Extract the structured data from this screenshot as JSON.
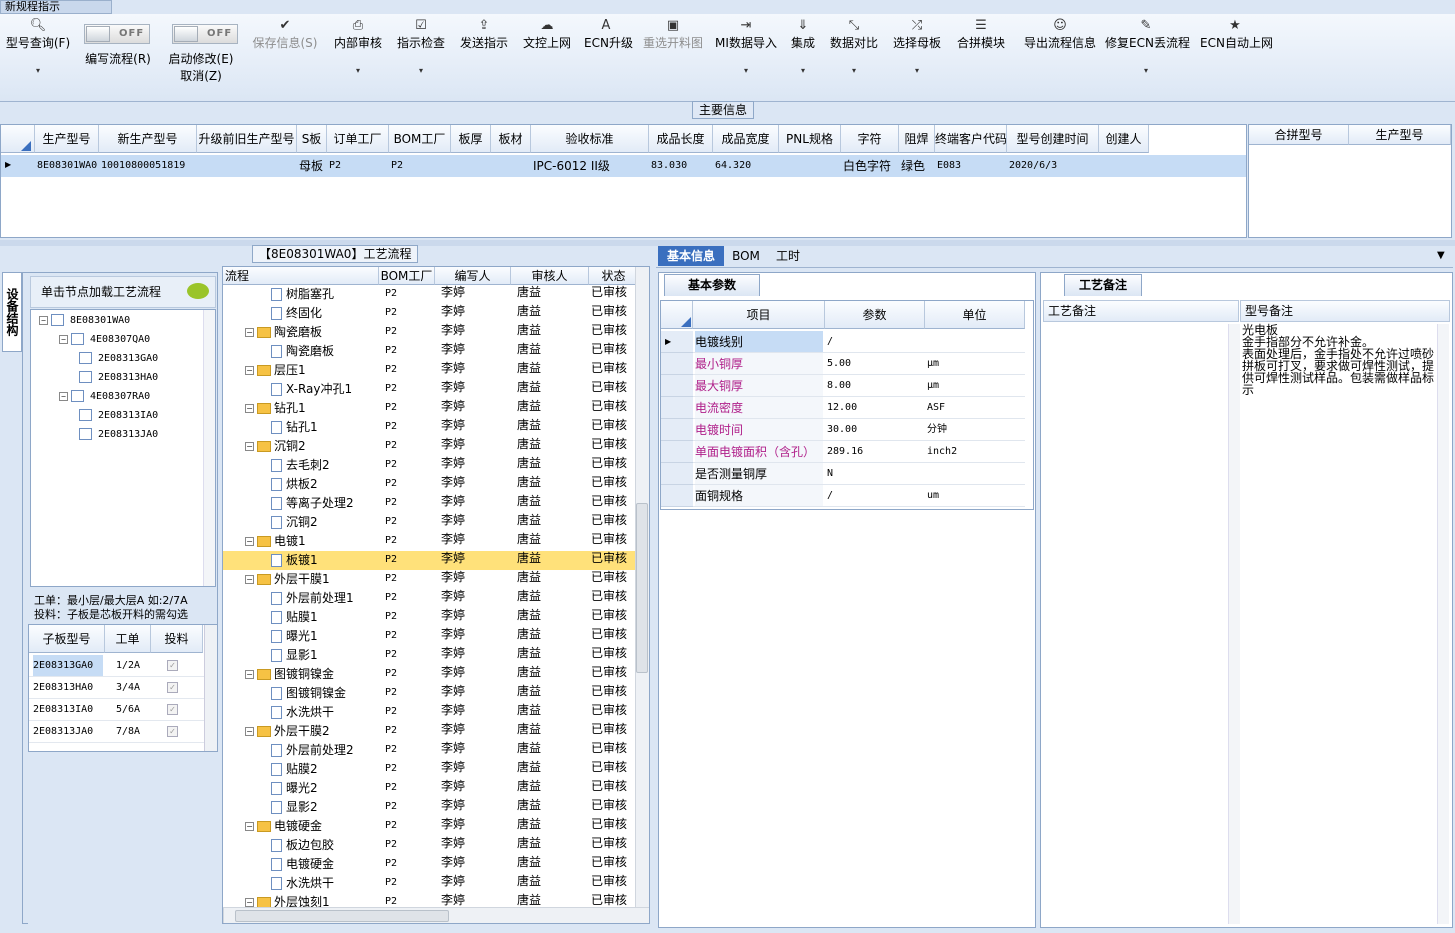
{
  "window": {
    "title": "新规程指示"
  },
  "toolbar": {
    "items": [
      {
        "label": "型号查询(F)",
        "icon": "search-icon"
      },
      {
        "label": "编写流程(R)",
        "icon": "toggle"
      },
      {
        "label": "启动修改(E)",
        "icon": "toggle"
      },
      {
        "label": "取消(Z)",
        "icon": ""
      },
      {
        "label": "保存信息(S)",
        "icon": "check-icon"
      },
      {
        "label": "内部审核",
        "icon": "print-icon"
      },
      {
        "label": "指示检查",
        "icon": "checkbox-icon"
      },
      {
        "label": "发送指示",
        "icon": "upload-icon"
      },
      {
        "label": "文控上网",
        "icon": "cloud-upload-icon"
      },
      {
        "label": "ECN升级",
        "icon": "font-icon"
      },
      {
        "label": "重选开料图",
        "icon": "image-icon"
      },
      {
        "label": "MI数据导入",
        "icon": "import-icon"
      },
      {
        "label": "集成",
        "icon": "download-icon"
      },
      {
        "label": "数据对比",
        "icon": "compress-icon"
      },
      {
        "label": "选择母板",
        "icon": "shuffle-icon"
      },
      {
        "label": "合拼模块",
        "icon": "list-icon"
      },
      {
        "label": "导出流程信息",
        "icon": "smile-icon"
      },
      {
        "label": "修复ECN丢流程",
        "icon": "wrench-icon"
      },
      {
        "label": "ECN自动上网",
        "icon": "star-icon"
      }
    ],
    "toggle_off": "OFF"
  },
  "main_info": {
    "section_label": "主要信息",
    "columns": [
      "生产型号",
      "新生产型号",
      "升级前旧生产型号",
      "S板",
      "订单工厂",
      "BOM工厂",
      "板厚",
      "板材",
      "验收标准",
      "成品长度",
      "成品宽度",
      "PNL规格",
      "字符",
      "阻焊",
      "终端客户代码",
      "型号创建时间",
      "创建人"
    ],
    "row": [
      "8E08301WA0",
      "10010800051819",
      "",
      "母板",
      "P2",
      "P2",
      "",
      "",
      "IPC-6012 II级",
      "83.030",
      "64.320",
      "",
      "白色字符",
      "绿色",
      "E083",
      "2020/6/3",
      ""
    ],
    "right_columns": [
      "合拼型号",
      "生产型号"
    ]
  },
  "left_panel": {
    "side_tab": "设备结构",
    "hint": "单击节点加载工艺流程",
    "tree": [
      {
        "label": "8E08301WA0",
        "level": 0
      },
      {
        "label": "4E08307QA0",
        "level": 1
      },
      {
        "label": "2E08313GA0",
        "level": 2
      },
      {
        "label": "2E08313HA0",
        "level": 2
      },
      {
        "label": "4E08307RA0",
        "level": 1
      },
      {
        "label": "2E08313IA0",
        "level": 2
      },
      {
        "label": "2E08313JA0",
        "level": 2
      }
    ],
    "note1": "工单：最小层/最大层A 如:2/7A",
    "note2": "投料：子板是芯板开料的需勾选",
    "sub_columns": [
      "子板型号",
      "工单",
      "投料"
    ],
    "sub_rows": [
      [
        "2E08313GA0",
        "1/2A"
      ],
      [
        "2E08313HA0",
        "3/4A"
      ],
      [
        "2E08313IA0",
        "5/6A"
      ],
      [
        "2E08313JA0",
        "7/8A"
      ]
    ]
  },
  "process_panel": {
    "title": "【8E08301WA0】工艺流程",
    "columns": [
      "流程",
      "BOM工厂",
      "编写人",
      "审核人",
      "状态"
    ],
    "rows": [
      {
        "name": "树脂塞孔",
        "type": "doc",
        "level": 2
      },
      {
        "name": "终固化",
        "type": "doc",
        "level": 2
      },
      {
        "name": "陶瓷磨板",
        "type": "folder",
        "level": 1
      },
      {
        "name": "陶瓷磨板",
        "type": "doc",
        "level": 2
      },
      {
        "name": "层压1",
        "type": "folder",
        "level": 1
      },
      {
        "name": "X-Ray冲孔1",
        "type": "doc",
        "level": 2
      },
      {
        "name": "钻孔1",
        "type": "folder",
        "level": 1
      },
      {
        "name": "钻孔1",
        "type": "doc",
        "level": 2
      },
      {
        "name": "沉铜2",
        "type": "folder",
        "level": 1
      },
      {
        "name": "去毛刺2",
        "type": "doc",
        "level": 2
      },
      {
        "name": "烘板2",
        "type": "doc",
        "level": 2
      },
      {
        "name": "等离子处理2",
        "type": "doc",
        "level": 2
      },
      {
        "name": "沉铜2",
        "type": "doc",
        "level": 2
      },
      {
        "name": "电镀1",
        "type": "folder",
        "level": 1
      },
      {
        "name": "板镀1",
        "type": "doc",
        "level": 2,
        "selected": true
      },
      {
        "name": "外层干膜1",
        "type": "folder",
        "level": 1
      },
      {
        "name": "外层前处理1",
        "type": "doc",
        "level": 2
      },
      {
        "name": "贴膜1",
        "type": "doc",
        "level": 2
      },
      {
        "name": "曝光1",
        "type": "doc",
        "level": 2
      },
      {
        "name": "显影1",
        "type": "doc",
        "level": 2
      },
      {
        "name": "图镀铜镍金",
        "type": "folder",
        "level": 1
      },
      {
        "name": "图镀铜镍金",
        "type": "doc",
        "level": 2
      },
      {
        "name": "水洗烘干",
        "type": "doc",
        "level": 2
      },
      {
        "name": "外层干膜2",
        "type": "folder",
        "level": 1
      },
      {
        "name": "外层前处理2",
        "type": "doc",
        "level": 2
      },
      {
        "name": "贴膜2",
        "type": "doc",
        "level": 2
      },
      {
        "name": "曝光2",
        "type": "doc",
        "level": 2
      },
      {
        "name": "显影2",
        "type": "doc",
        "level": 2
      },
      {
        "name": "电镀硬金",
        "type": "folder",
        "level": 1
      },
      {
        "name": "板边包胶",
        "type": "doc",
        "level": 2
      },
      {
        "name": "电镀硬金",
        "type": "doc",
        "level": 2
      },
      {
        "name": "水洗烘干",
        "type": "doc",
        "level": 2
      },
      {
        "name": "外层蚀刻1",
        "type": "folder",
        "level": 1
      }
    ],
    "bom": "P2",
    "writer": "李婷",
    "reviewer": "唐益",
    "status": "已审核"
  },
  "right_tabs": [
    "基本信息",
    "BOM",
    "工时"
  ],
  "basic_params": {
    "tab": "基本参数",
    "columns": [
      "项目",
      "参数",
      "单位"
    ],
    "rows": [
      [
        "电镀线别",
        "/",
        ""
      ],
      [
        "最小铜厚",
        "5.00",
        "μm"
      ],
      [
        "最大铜厚",
        "8.00",
        "μm"
      ],
      [
        "电流密度",
        "12.00",
        "ASF"
      ],
      [
        "电镀时间",
        "30.00",
        "分钟"
      ],
      [
        "单面电镀面积（含孔）",
        "289.16",
        "inch2"
      ],
      [
        "是否测量铜厚",
        "N",
        ""
      ],
      [
        "面铜规格",
        "/",
        "um"
      ]
    ]
  },
  "process_notes": {
    "tab": "工艺备注",
    "col1": "工艺备注",
    "col2": "型号备注",
    "model_note": "光电板\n金手指部分不允许补金。\n表面处理后，金手指处不允许过喷砂\n拼板可打叉，要求做可焊性测试，提供可焊性测试样品。包装需做样品标示"
  },
  "colors": {
    "accent": "#3a6fbf",
    "selected_row": "#c6dcf5",
    "highlight": "#ffe17a",
    "param_label": "#b0208a"
  }
}
